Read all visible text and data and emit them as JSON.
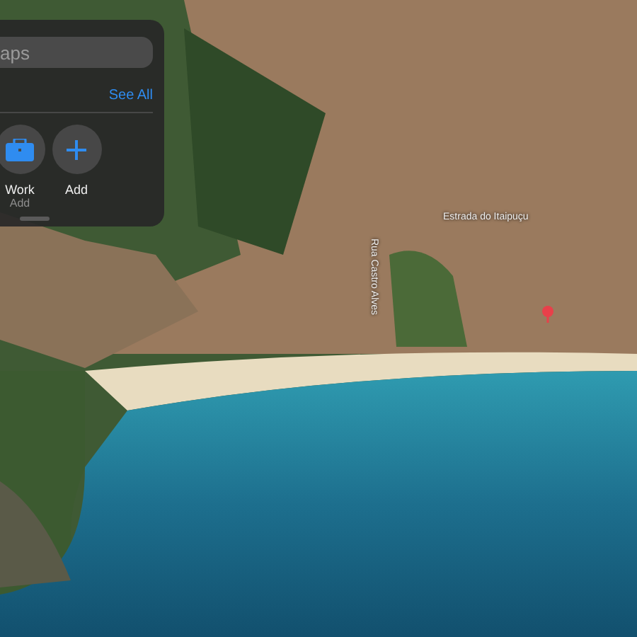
{
  "search": {
    "placeholder": "aps"
  },
  "favorites_header": {
    "link": "See All"
  },
  "favorites": [
    {
      "kind": "work",
      "label": "Work",
      "sublabel": "Add"
    },
    {
      "kind": "add",
      "label": "Add"
    }
  ],
  "map": {
    "labels": [
      {
        "kind": "horizontal",
        "text": "Estrada do Itaipuçu"
      },
      {
        "kind": "vertical",
        "text": "Rua Castro Alves"
      }
    ]
  }
}
